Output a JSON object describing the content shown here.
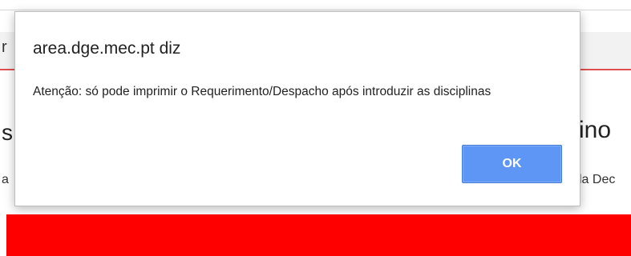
{
  "background_page": {
    "nav_fragment": "r",
    "heading_left_fragment": "s",
    "heading_right_fragment": "ino",
    "sub_left_fragment": "a",
    "sub_right_fragment": "la Dec",
    "band_color": "#ff0000"
  },
  "alert": {
    "title": "area.dge.mec.pt diz",
    "message": "Atenção: só pode imprimir o Requerimento/Despacho após introduzir as disciplinas",
    "ok_label": "OK",
    "ok_color": "#5d96f5"
  }
}
